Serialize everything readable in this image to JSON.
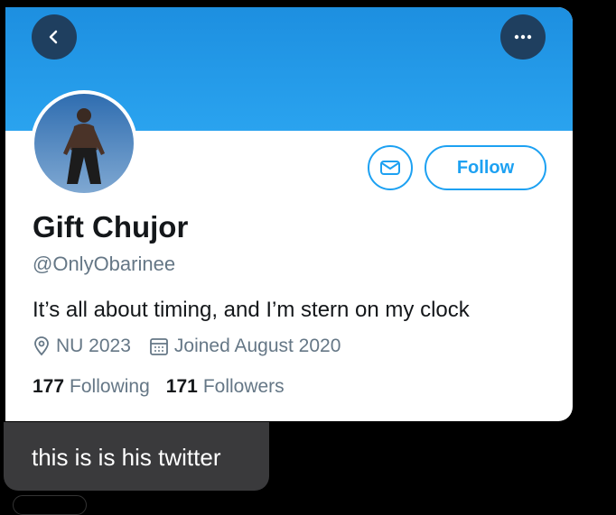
{
  "profile": {
    "name": "Gift Chujor",
    "handle": "@OnlyObarinee",
    "bio": "It’s all about timing, and I’m stern on my clock",
    "location": "NU 2023",
    "joined": "Joined August 2020",
    "following_count": "177",
    "following_label": "Following",
    "followers_count": "171",
    "followers_label": "Followers"
  },
  "actions": {
    "back_icon": "chevron-left-icon",
    "more_icon": "more-horizontal-icon",
    "message_icon": "mail-icon",
    "follow_label": "Follow"
  },
  "message": {
    "text": "this is is his twitter"
  },
  "colors": {
    "banner": "#1d8fe0",
    "accent": "#1da1f2",
    "bubble": "#3a3a3c"
  }
}
